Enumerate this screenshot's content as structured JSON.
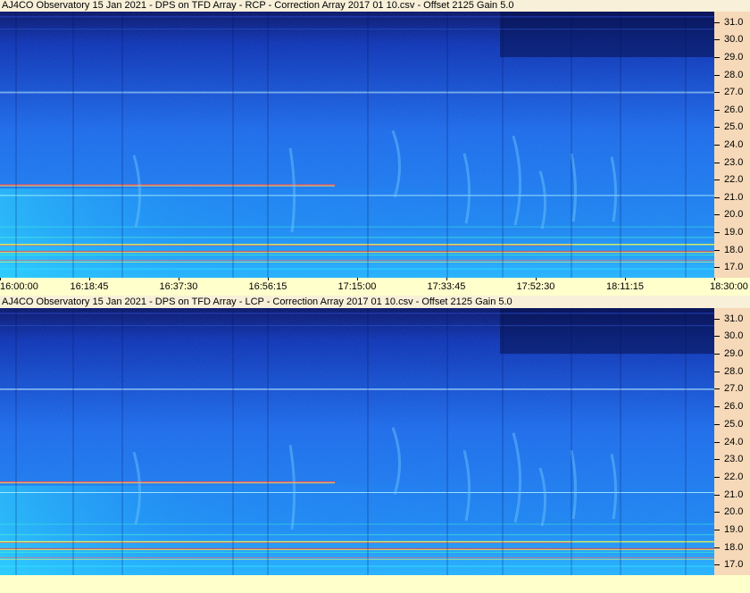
{
  "chart_data": [
    {
      "type": "heatmap",
      "title": "AJ4CO Observatory 15 Jan 2021  -  DPS on TFD Array  -  RCP  -  Correction Array 2017 01 10.csv  -  Offset 2125  Gain 5.0",
      "polarization": "RCP",
      "y_ticks": [
        "31.0",
        "30.0",
        "29.0",
        "28.0",
        "27.0",
        "26.0",
        "25.0",
        "24.0",
        "23.0",
        "22.0",
        "21.0",
        "20.0",
        "19.0",
        "18.0",
        "17.0"
      ],
      "ylim": [
        16.4,
        31.6
      ],
      "x_ticks": [
        "16:00:00",
        "16:18:45",
        "16:37:30",
        "16:56:15",
        "17:15:00",
        "17:33:45",
        "17:52:30",
        "18:11:15",
        "18:30:00"
      ],
      "colormap": [
        "#0a1060",
        "#1030b0",
        "#1f6ae8",
        "#20c8ff",
        "#40ffd0",
        "#ffff40",
        "#ff4040"
      ]
    },
    {
      "type": "heatmap",
      "title": "AJ4CO Observatory 15 Jan 2021  -  DPS on TFD Array  -  LCP  -  Correction Array 2017 01 10.csv  -  Offset 2125  Gain 5.0",
      "polarization": "LCP",
      "y_ticks": [
        "31.0",
        "30.0",
        "29.0",
        "28.0",
        "27.0",
        "26.0",
        "25.0",
        "24.0",
        "23.0",
        "22.0",
        "21.0",
        "20.0",
        "19.0",
        "18.0",
        "17.0"
      ],
      "ylim": [
        16.4,
        31.6
      ],
      "colormap": [
        "#0a1060",
        "#1030b0",
        "#1f6ae8",
        "#20c8ff",
        "#40ffd0",
        "#ffff40",
        "#ff4040"
      ]
    }
  ]
}
